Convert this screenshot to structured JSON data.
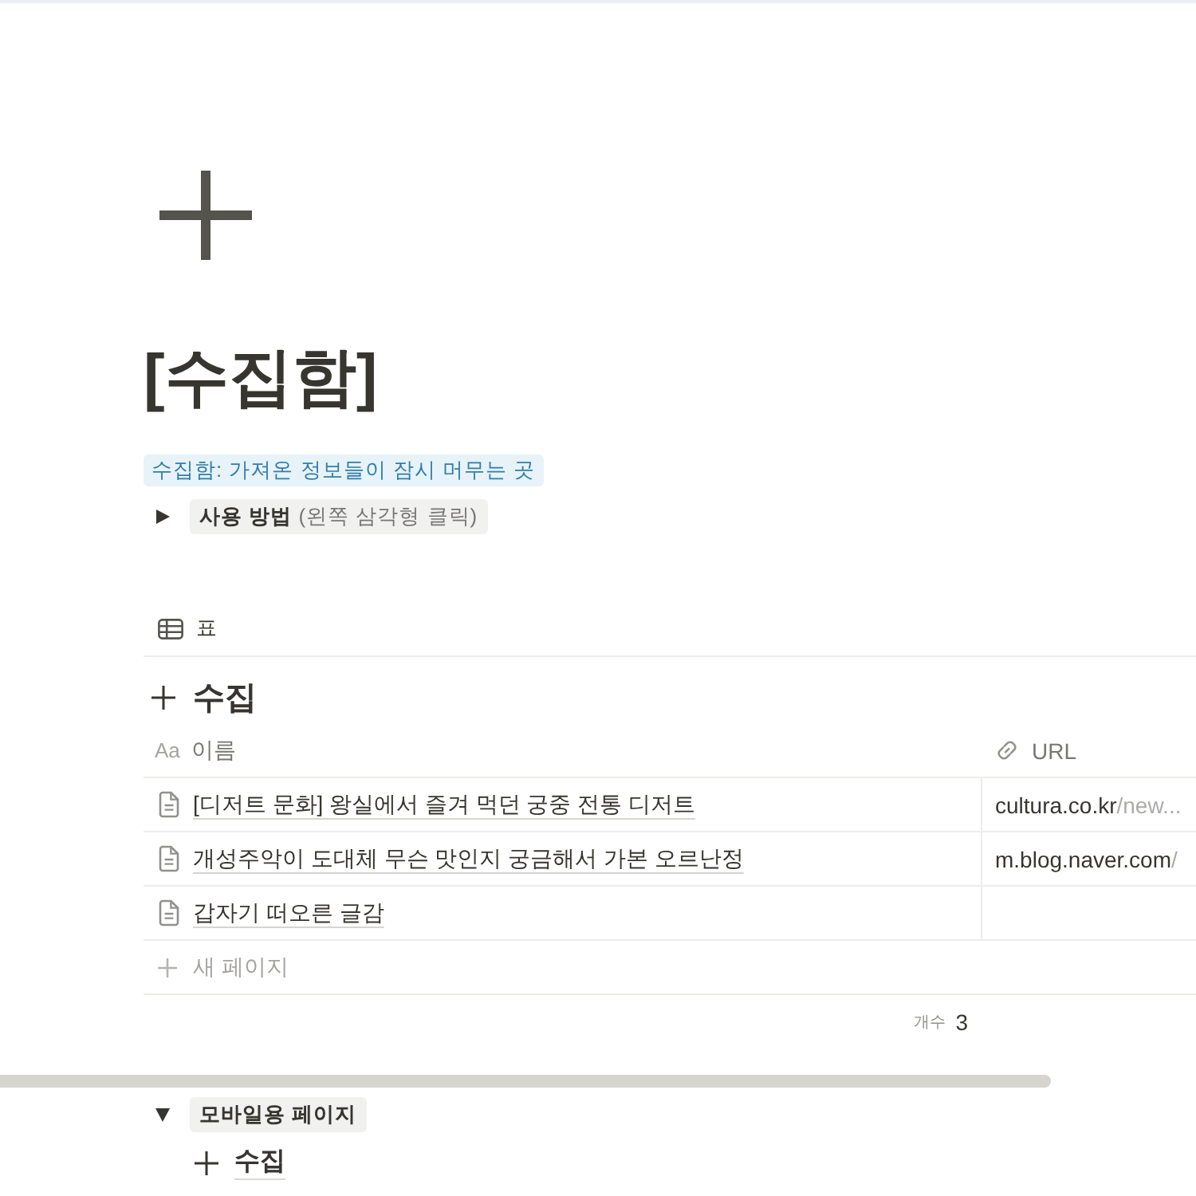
{
  "page": {
    "title": "[수집함]"
  },
  "blocks": [
    {
      "kind": "highlight",
      "text": "수집함: 가져온 정보들이 잠시 머무는 곳"
    },
    {
      "kind": "toggle",
      "label": "사용 방법",
      "hint": "(왼쪽 삼각형 클릭)",
      "expanded": false
    },
    {
      "kind": "database",
      "view_tab": "표",
      "title": "수집",
      "columns": [
        {
          "kind": "title",
          "type_icon": "Aa",
          "label": "이름"
        },
        {
          "kind": "url",
          "label": "URL"
        }
      ],
      "rows": [
        {
          "name": "[디저트 문화] 왕실에서 즐겨 먹던 궁중 전통 디저트",
          "url": {
            "host": "cultura.co.kr",
            "path": "/new..."
          }
        },
        {
          "name": "개성주악이 도대체 무슨 맛인지 궁금해서 가본 오르난정",
          "url": {
            "host": "m.blog.naver.com",
            "path": "/"
          }
        },
        {
          "name": "갑자기 떠오른 글감"
        }
      ],
      "new_row": "새 페이지",
      "count_label": "개수",
      "count": "3"
    },
    {
      "kind": "toggle",
      "label": "모바일용 페이지",
      "expanded": true,
      "children": [
        {
          "kind": "linked_database",
          "title": "수집"
        }
      ]
    }
  ]
}
